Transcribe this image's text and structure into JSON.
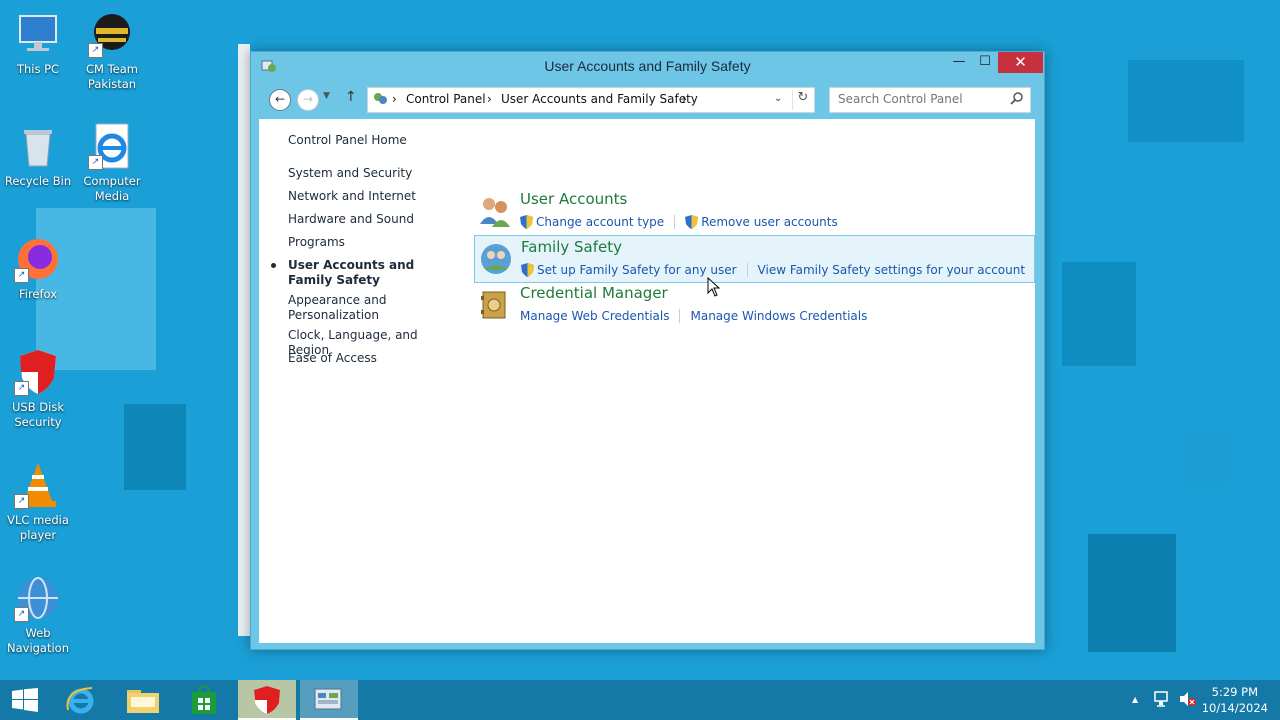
{
  "desktop": {
    "icons": [
      {
        "label1": "This PC",
        "label2": ""
      },
      {
        "label1": "CM Team",
        "label2": "Pakistan"
      },
      {
        "label1": "Recycle Bin",
        "label2": ""
      },
      {
        "label1": "Computer",
        "label2": "Media"
      },
      {
        "label1": "Firefox",
        "label2": ""
      },
      {
        "label1": "USB Disk",
        "label2": "Security"
      },
      {
        "label1": "VLC media",
        "label2": "player"
      },
      {
        "label1": "Web",
        "label2": "Navigation"
      }
    ]
  },
  "window": {
    "title": "User Accounts and Family Safety",
    "controls": {
      "minimize": "—",
      "maximize": "☐",
      "close": "✕"
    },
    "address": {
      "crumbs": [
        "Control Panel",
        "User Accounts and Family Safety"
      ],
      "separator": "›"
    },
    "search": {
      "placeholder": "Search Control Panel"
    },
    "sidebar": {
      "home": "Control Panel Home",
      "items": [
        "System and Security",
        "Network and Internet",
        "Hardware and Sound",
        "Programs",
        "User Accounts and Family Safety",
        "Appearance and Personalization",
        "Clock, Language, and Region",
        "Ease of Access"
      ],
      "active_index": 4
    },
    "categories": [
      {
        "title": "User Accounts",
        "links": [
          "Change account type",
          "Remove user accounts"
        ]
      },
      {
        "title": "Family Safety",
        "links": [
          "Set up Family Safety for any user",
          "View Family Safety settings for your account"
        ]
      },
      {
        "title": "Credential Manager",
        "links": [
          "Manage Web Credentials",
          "Manage Windows Credentials"
        ]
      }
    ]
  },
  "taskbar": {
    "clock": {
      "time": "5:29 PM",
      "date": "10/14/2024"
    },
    "tray": {
      "up_arrow": "▲"
    }
  },
  "colors": {
    "accent": "#1a9fd6",
    "link": "#1a56b0",
    "category_title": "#1e7a3c",
    "close": "#c7303f"
  }
}
